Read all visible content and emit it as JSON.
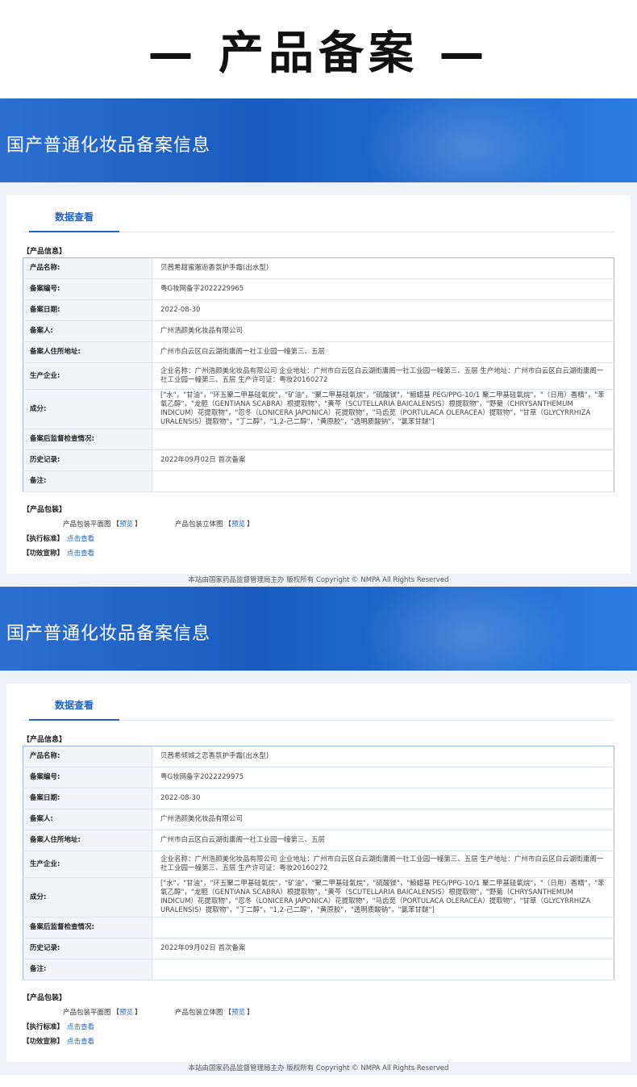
{
  "page_title": "— 产品备案 —",
  "records": [
    {
      "banner_title": "国产普通化妆品备案信息",
      "tab": "数据查看",
      "product_info_label": "【产品信息】",
      "rows": [
        {
          "key": "产品名称:",
          "value": "贝茜希甜蜜邂逅香氛护手霜(出水型)"
        },
        {
          "key": "备案编号:",
          "value": "粤G妆网备字2022229965"
        },
        {
          "key": "备案日期:",
          "value": "2022-08-30"
        },
        {
          "key": "备案人:",
          "value": "广州浩颜美化妆品有限公司"
        },
        {
          "key": "备案人住所地址:",
          "value": "广州市白云区白云湖街庸阁一社工业园一幢第三、五层"
        },
        {
          "key": "生产企业:",
          "value": "企业名称：广州浩颜美化妆品有限公司 企业地址：广州市白云区白云湖街庸阁一社工业园一幢第三、五层 生产地址：广州市白云区白云湖街庸阁一社工业园一幢第三、五层 生产许可证：粤妆20160272"
        },
        {
          "key": "成分:",
          "value": "[\"水\"，\"甘油\"，\"环五聚二甲基硅氧烷\"，\"矿油\"，\"聚二甲基硅氧烷\"，\"硫酸镁\"，\"鲸蜡基 PEG/PPG-10/1 聚二甲基硅氧烷\"，\"（日用）香精\"，\"苯氧乙醇\"，\"龙胆（GENTIANA SCABRA）根提取物\"，\"黄芩（SCUTELLARIA BAICALENSIS）根提取物\"，\"野菊（CHRYSANTHEMUM INDICUM）花提取物\"，\"忍冬（LONICERA JAPONICA）花提取物\"，\"马齿苋（PORTULACA OLERACEA）提取物\"，\"甘草（GLYCYRRHIZA URALENSIS）提取物\"，\"丁二醇\"，\"1,2-己二醇\"，\"黄原胶\"，\"透明质酸钠\"，\"氯苯甘醚\"]"
        },
        {
          "key": "备案后监督检查情况:",
          "value": ""
        },
        {
          "key": "历史记录:",
          "value": "2022年09月02日 首次备案"
        },
        {
          "key": "备注:",
          "value": ""
        }
      ],
      "package_label": "【产品包装】",
      "pkg_flat": "产品包装平面图",
      "pkg_3d": "产品包装立体图",
      "preview": "预览",
      "standard_label": "【执行标准】",
      "efficacy_label": "【功效宣称】",
      "click_view": "点击查看",
      "footer": "本站由国家药品监督管理局主办 版权所有 Copyright © NMPA All Rights Reserved"
    },
    {
      "banner_title": "国产普通化妆品备案信息",
      "tab": "数据查看",
      "product_info_label": "【产品信息】",
      "rows": [
        {
          "key": "产品名称:",
          "value": "贝茜希倾城之恋香氛护手霜(出水型)"
        },
        {
          "key": "备案编号:",
          "value": "粤G妆网备字2022229975"
        },
        {
          "key": "备案日期:",
          "value": "2022-08-30"
        },
        {
          "key": "备案人:",
          "value": "广州浩颜美化妆品有限公司"
        },
        {
          "key": "备案人住所地址:",
          "value": "广州市白云区白云湖街庸阁一社工业园一幢第三、五层"
        },
        {
          "key": "生产企业:",
          "value": "企业名称：广州浩颜美化妆品有限公司 企业地址：广州市白云区白云湖街庸阁一社工业园一幢第三、五层 生产地址：广州市白云区白云湖街庸阁一社工业园一幢第三、五层 生产许可证：粤妆20160272"
        },
        {
          "key": "成分:",
          "value": "[\"水\"，\"甘油\"，\"环五聚二甲基硅氧烷\"，\"矿油\"，\"聚二甲基硅氧烷\"，\"硫酸镁\"，\"鲸蜡基 PEG/PPG-10/1 聚二甲基硅氧烷\"，\"（日用）香精\"，\"苯氧乙醇\"，\"龙胆（GENTIANA SCABRA）根提取物\"，\"黄芩（SCUTELLARIA BAICALENSIS）根提取物\"，\"野菊（CHRYSANTHEMUM INDICUM）花提取物\"，\"忍冬（LONICERA JAPONICA）花提取物\"，\"马齿苋（PORTULACA OLERACEA）提取物\"，\"甘草（GLYCYRRHIZA URALENSIS）提取物\"，\"丁二醇\"，\"1,2-己二醇\"，\"黄原胶\"，\"透明质酸钠\"，\"氯苯甘醚\"]"
        },
        {
          "key": "备案后监督检查情况:",
          "value": ""
        },
        {
          "key": "历史记录:",
          "value": "2022年09月02日 首次备案"
        },
        {
          "key": "备注:",
          "value": ""
        }
      ],
      "package_label": "【产品包装】",
      "pkg_flat": "产品包装平面图",
      "pkg_3d": "产品包装立体图",
      "preview": "预览",
      "standard_label": "【执行标准】",
      "efficacy_label": "【功效宣称】",
      "click_view": "点击查看",
      "footer": "本站由国家药品监督管理局主办 版权所有 Copyright © NMPA All Rights Reserved"
    }
  ]
}
